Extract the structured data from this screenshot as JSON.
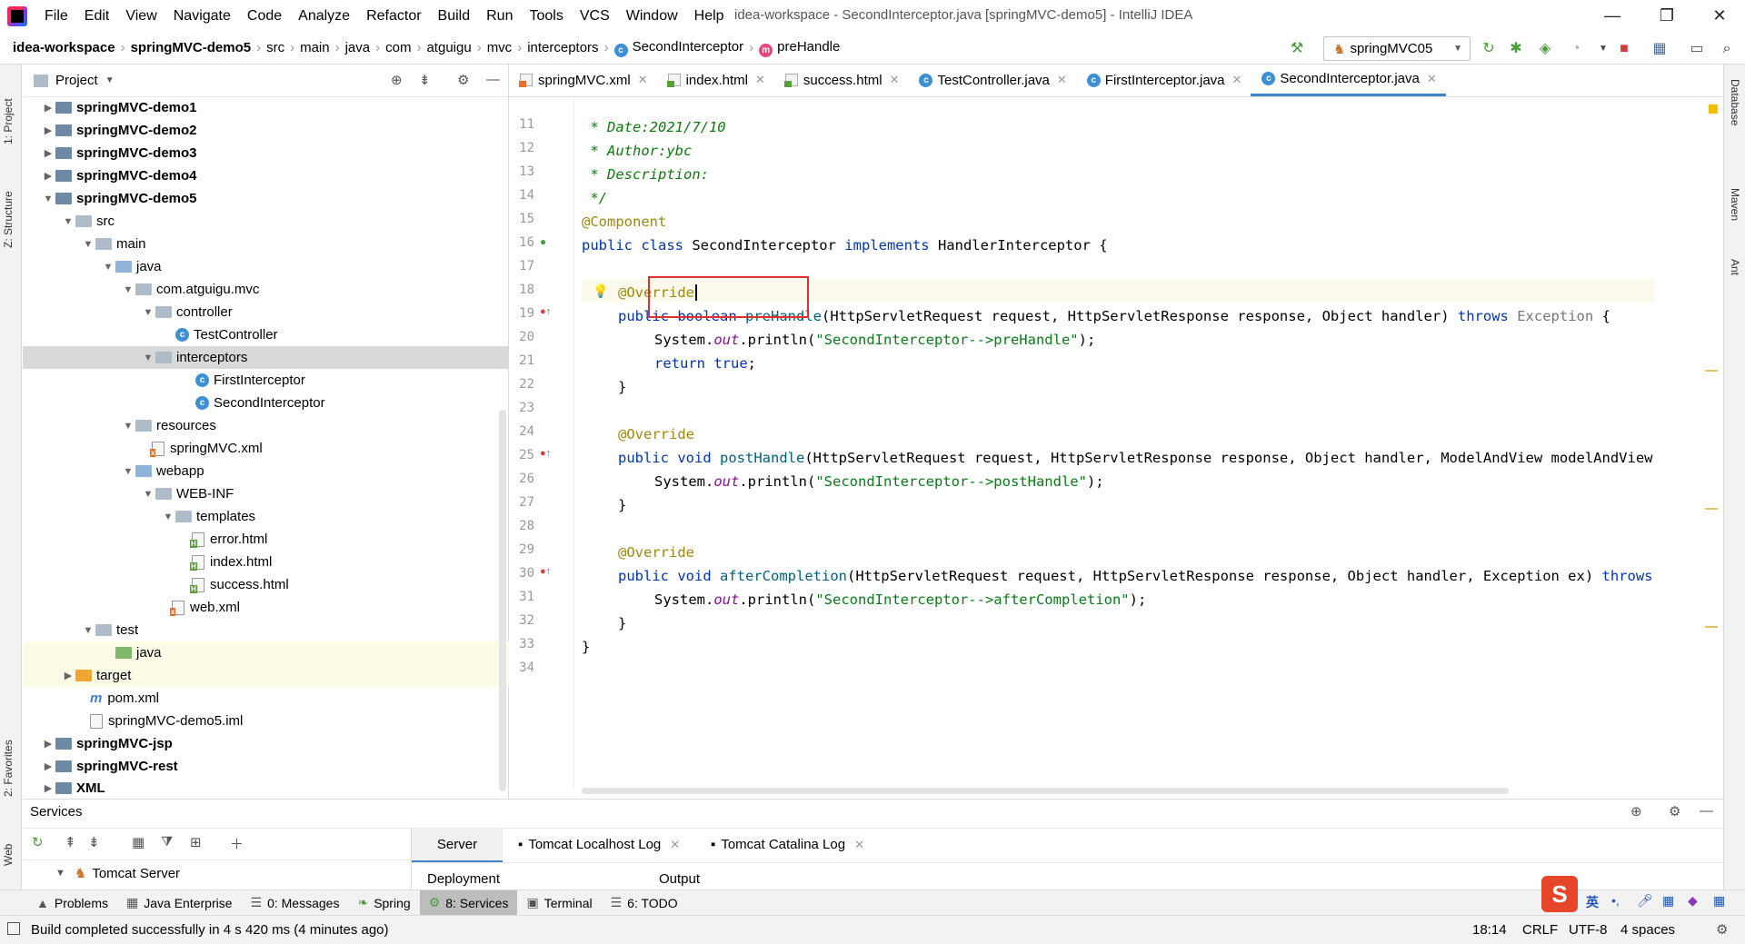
{
  "menubar": {
    "items": [
      "File",
      "Edit",
      "View",
      "Navigate",
      "Code",
      "Analyze",
      "Refactor",
      "Build",
      "Run",
      "Tools",
      "VCS",
      "Window",
      "Help"
    ],
    "window_title": "idea-workspace - SecondInterceptor.java [springMVC-demo5] - IntelliJ IDEA"
  },
  "breadcrumbs": [
    "idea-workspace",
    "springMVC-demo5",
    "src",
    "main",
    "java",
    "com",
    "atguigu",
    "mvc",
    "interceptors",
    "SecondInterceptor",
    "preHandle"
  ],
  "run_config": "springMVC05",
  "left_tabs": {
    "project": "1: Project",
    "structure": "Z: Structure",
    "favorites": "2: Favorites",
    "web": "Web"
  },
  "right_tabs": {
    "database": "Database",
    "maven": "Maven",
    "ant": "Ant"
  },
  "project_panel": {
    "title": "Project",
    "tree": [
      {
        "label": "springMVC-demo1",
        "bold": true
      },
      {
        "label": "springMVC-demo2",
        "bold": true
      },
      {
        "label": "springMVC-demo3",
        "bold": true
      },
      {
        "label": "springMVC-demo4",
        "bold": true
      },
      {
        "label": "springMVC-demo5",
        "bold": true
      },
      {
        "label": "src"
      },
      {
        "label": "main"
      },
      {
        "label": "java"
      },
      {
        "label": "com.atguigu.mvc"
      },
      {
        "label": "controller"
      },
      {
        "label": "TestController"
      },
      {
        "label": "interceptors"
      },
      {
        "label": "FirstInterceptor"
      },
      {
        "label": "SecondInterceptor"
      },
      {
        "label": "resources"
      },
      {
        "label": "springMVC.xml"
      },
      {
        "label": "webapp"
      },
      {
        "label": "WEB-INF"
      },
      {
        "label": "templates"
      },
      {
        "label": "error.html"
      },
      {
        "label": "index.html"
      },
      {
        "label": "success.html"
      },
      {
        "label": "web.xml"
      },
      {
        "label": "test"
      },
      {
        "label": "java"
      },
      {
        "label": "target"
      },
      {
        "label": "pom.xml"
      },
      {
        "label": "springMVC-demo5.iml"
      },
      {
        "label": "springMVC-jsp",
        "bold": true
      },
      {
        "label": "springMVC-rest",
        "bold": true
      },
      {
        "label": "XML",
        "bold": true
      }
    ]
  },
  "editor_tabs": [
    {
      "label": "springMVC.xml"
    },
    {
      "label": "index.html"
    },
    {
      "label": "success.html"
    },
    {
      "label": "TestController.java"
    },
    {
      "label": "FirstInterceptor.java"
    },
    {
      "label": "SecondInterceptor.java",
      "active": true
    }
  ],
  "code": {
    "line_numbers": [
      "11",
      "12",
      "13",
      "14",
      "15",
      "16",
      "17",
      "18",
      "19",
      "20",
      "21",
      "22",
      "23",
      "24",
      "25",
      "26",
      "27",
      "28",
      "29",
      "30",
      "31",
      "32",
      "33",
      "34"
    ],
    "l11": " * Date:2021/7/10",
    "l12": " * Author:ybc",
    "l13": " * Description:",
    "l14": " */",
    "l15": "@Component",
    "l16_kw": "public class",
    "l16_name": " SecondInterceptor ",
    "l16_impl": "implements",
    "l16_rest": " HandlerInterceptor {",
    "ann_override": "@Override",
    "l19_kw": "public boolean",
    "l19_m": "preHandle",
    "l19_args": "(HttpServletRequest request, HttpServletResponse response, Object handler) ",
    "l19_throws": "throws",
    "l19_exc": " Exception",
    "l19_end": " {",
    "sys": "System.",
    "out": "out",
    "println": ".println(",
    "l20_str": "\"SecondInterceptor-->preHandle\"",
    "end_call": ");",
    "l21_kw": "return true",
    "l21_end": ";",
    "close": "}",
    "l25_kw": "public void",
    "l25_m": "postHandle",
    "l25_args": "(HttpServletRequest request, HttpServletResponse response, Object handler, ModelAndView modelAndView",
    "l26_str": "\"SecondInterceptor-->postHandle\"",
    "l30_m": "afterCompletion",
    "l30_args": "(HttpServletRequest request, HttpServletResponse response, Object handler, Exception ex) ",
    "l30_throws": "throws",
    "l31_str": "\"SecondInterceptor-->afterCompletion\""
  },
  "services": {
    "title": "Services",
    "tree_item": "Tomcat Server",
    "tabs": [
      "Server",
      "Tomcat Localhost Log",
      "Tomcat Catalina Log"
    ],
    "deployment": "Deployment",
    "output": "Output"
  },
  "bottom_tabs": [
    "Problems",
    "Java Enterprise",
    "0: Messages",
    "Spring",
    "8: Services",
    "Terminal",
    "6: TODO"
  ],
  "status": {
    "message": "Build completed successfully in 4 s 420 ms (4 minutes ago)",
    "position": "18:14",
    "line_ending": "CRLF",
    "encoding": "UTF-8",
    "indent": "4 spaces",
    "ime": "英"
  }
}
